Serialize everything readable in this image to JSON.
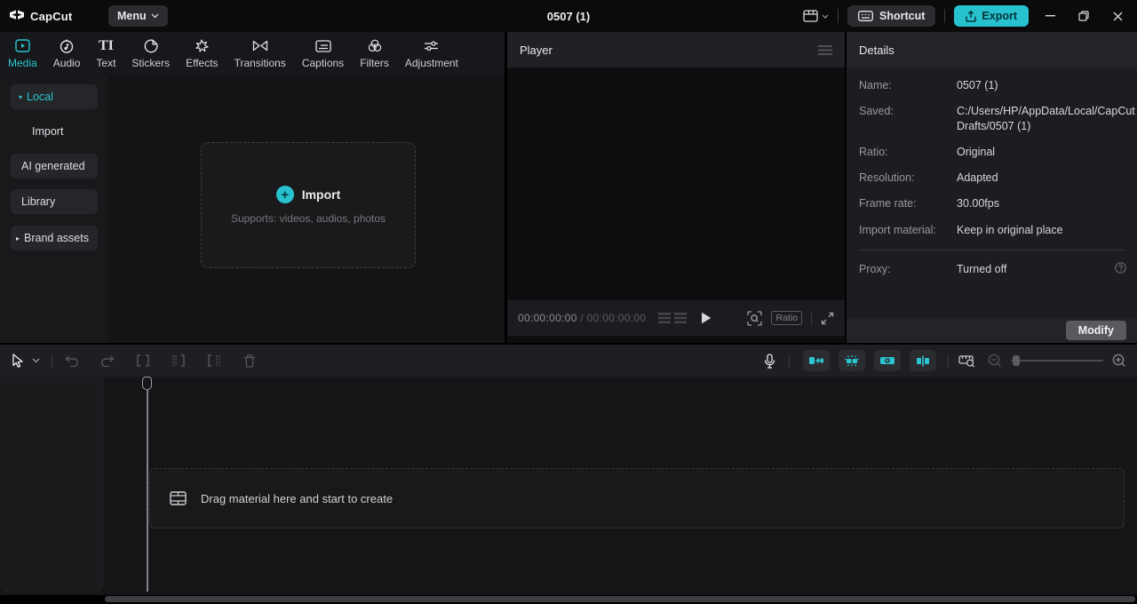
{
  "colors": {
    "accent": "#2bc6d1",
    "export_bg": "#27c2ce",
    "topbar_bg": "#0b0b0c"
  },
  "topbar": {
    "logo_text": "CapCut",
    "menu_label": "Menu",
    "title": "0507 (1)",
    "shortcut_label": "Shortcut",
    "export_label": "Export"
  },
  "tabs": [
    {
      "label": "Media",
      "active": true
    },
    {
      "label": "Audio",
      "active": false
    },
    {
      "label": "Text",
      "active": false,
      "glyph": "TI"
    },
    {
      "label": "Stickers",
      "active": false
    },
    {
      "label": "Effects",
      "active": false
    },
    {
      "label": "Transitions",
      "active": false
    },
    {
      "label": "Captions",
      "active": false
    },
    {
      "label": "Filters",
      "active": false
    },
    {
      "label": "Adjustment",
      "active": false
    }
  ],
  "sidebar": {
    "items": [
      {
        "label": "Local",
        "active": true,
        "expander": "▾"
      },
      {
        "label": "Import",
        "active": false
      },
      {
        "label": "AI generated",
        "active": false
      },
      {
        "label": "Library",
        "active": false
      },
      {
        "label": "Brand assets",
        "active": false,
        "expander": "▸"
      }
    ]
  },
  "import_box": {
    "label": "Import",
    "hint": "Supports: videos, audios, photos"
  },
  "player": {
    "title": "Player",
    "current_time": "00:00:00:00",
    "time_separator": " / ",
    "total_time": "00:00:00:00",
    "ratio_label": "Ratio"
  },
  "details": {
    "title": "Details",
    "rows": [
      {
        "label": "Name:",
        "value": "0507 (1)"
      },
      {
        "label": "Saved:",
        "value": "C:/Users/HP/AppData/Local/CapCut Drafts/0507 (1)"
      },
      {
        "label": "Ratio:",
        "value": "Original"
      },
      {
        "label": "Resolution:",
        "value": "Adapted"
      },
      {
        "label": "Frame rate:",
        "value": "30.00fps"
      },
      {
        "label": "Import material:",
        "value": "Keep in original place"
      }
    ],
    "proxy": {
      "label": "Proxy:",
      "value": "Turned off"
    },
    "modify_label": "Modify"
  },
  "timeline": {
    "drop_hint": "Drag material here and start to create"
  }
}
